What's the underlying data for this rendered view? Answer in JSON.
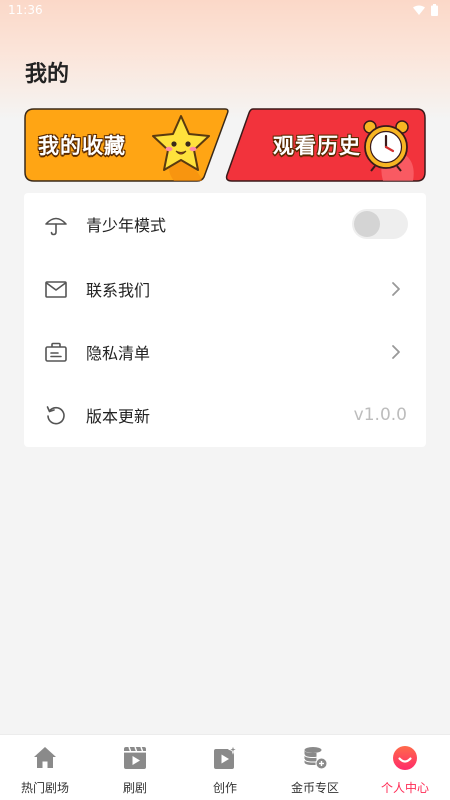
{
  "status_bar": {
    "time": "11:36"
  },
  "page": {
    "title": "我的"
  },
  "cards": {
    "favorites": {
      "label": "我的收藏"
    },
    "history": {
      "label": "观看历史"
    }
  },
  "menu": {
    "teen_mode": {
      "label": "青少年模式",
      "enabled": false
    },
    "contact": {
      "label": "联系我们"
    },
    "privacy": {
      "label": "隐私清单"
    },
    "version": {
      "label": "版本更新",
      "value": "v1.0.0"
    }
  },
  "tabbar": {
    "items": [
      {
        "label": "热门剧场",
        "icon": "home-icon"
      },
      {
        "label": "刷剧",
        "icon": "video-icon"
      },
      {
        "label": "创作",
        "icon": "create-icon"
      },
      {
        "label": "金币专区",
        "icon": "coin-icon"
      },
      {
        "label": "个人中心",
        "icon": "profile-icon"
      }
    ],
    "active_index": 4,
    "active_color": "#ff2b55"
  },
  "colors": {
    "favorites_card": "#ffa514",
    "history_card": "#f2333c",
    "accent": "#ff2b55"
  }
}
